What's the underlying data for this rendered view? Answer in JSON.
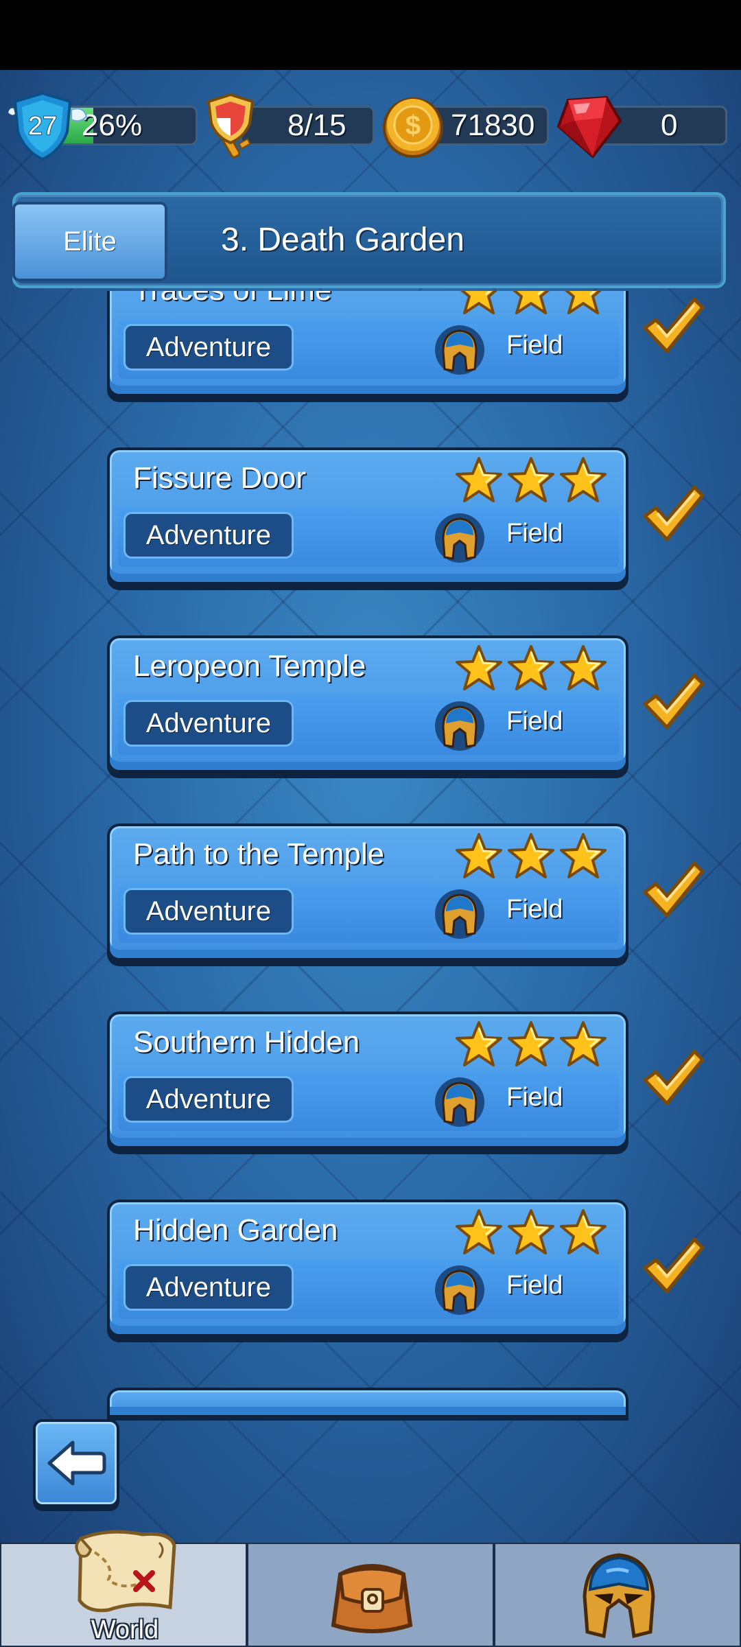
{
  "top_bar": {
    "level": "27",
    "xp_percent_label": "26%",
    "xp_fraction": 0.26,
    "keys": "8/15",
    "gold": "71830",
    "gems": "0"
  },
  "stage": {
    "mode_tab": "Elite",
    "title": "3. Death Garden"
  },
  "levels": [
    {
      "name": "Traces of Lime",
      "tag": "Adventure",
      "type": "Field",
      "stars": 3,
      "cleared": true
    },
    {
      "name": "Fissure Door",
      "tag": "Adventure",
      "type": "Field",
      "stars": 3,
      "cleared": true
    },
    {
      "name": "Leropeon Temple",
      "tag": "Adventure",
      "type": "Field",
      "stars": 3,
      "cleared": true
    },
    {
      "name": "Path to the Temple",
      "tag": "Adventure",
      "type": "Field",
      "stars": 3,
      "cleared": true
    },
    {
      "name": "Southern Hidden",
      "tag": "Adventure",
      "type": "Field",
      "stars": 3,
      "cleared": true
    },
    {
      "name": "Hidden Garden",
      "tag": "Adventure",
      "type": "Field",
      "stars": 3,
      "cleared": true
    }
  ],
  "nav": {
    "world_label": "World",
    "items": [
      "world-map-icon",
      "bag-icon",
      "helmet-icon"
    ]
  },
  "colors": {
    "card": "#4a9be8",
    "pill": "#1d4d86",
    "star": "#ffc21a",
    "check": "#f5b221"
  }
}
